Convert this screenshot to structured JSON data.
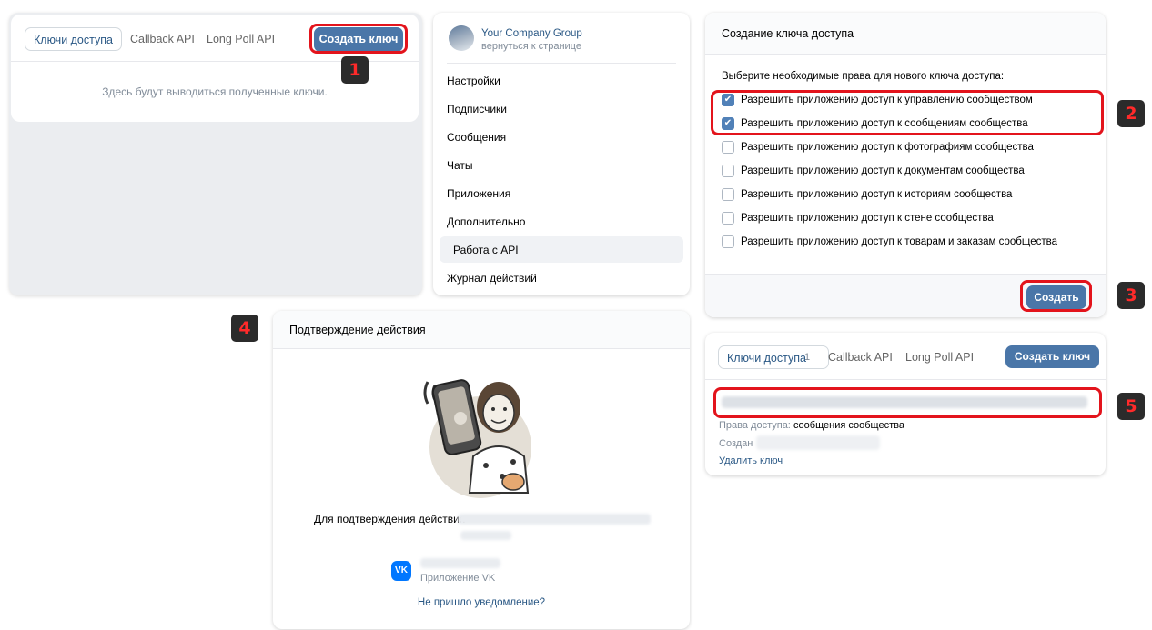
{
  "panel1": {
    "tabs": [
      "Ключи доступа",
      "Callback API",
      "Long Poll API"
    ],
    "create_key_button": "Создать ключ",
    "empty_text": "Здесь будут выводиться полученные ключи.",
    "badge": "1"
  },
  "menu": {
    "group_name": "Your Company Group",
    "back_link": "вернуться к странице",
    "items": [
      "Настройки",
      "Подписчики",
      "Сообщения",
      "Чаты",
      "Приложения",
      "Дополнительно",
      "Работа с API",
      "Журнал действий"
    ],
    "active_item": "Работа с API"
  },
  "panel2": {
    "title": "Создание ключа доступа",
    "intro": "Выберите необходимые права для нового ключа доступа:",
    "permissions": [
      {
        "label": "Разрешить приложению доступ к управлению сообществом",
        "checked": true
      },
      {
        "label": "Разрешить приложению доступ к сообщениям сообщества",
        "checked": true
      },
      {
        "label": "Разрешить приложению доступ к фотографиям сообщества",
        "checked": false
      },
      {
        "label": "Разрешить приложению доступ к документам сообщества",
        "checked": false
      },
      {
        "label": "Разрешить приложению доступ к историям сообщества",
        "checked": false
      },
      {
        "label": "Разрешить приложению доступ к стене сообщества",
        "checked": false
      },
      {
        "label": "Разрешить приложению доступ к товарам и заказам сообщества",
        "checked": false
      }
    ],
    "create_button": "Создать",
    "badge_permissions": "2",
    "badge_create": "3"
  },
  "panel4": {
    "title": "Подтверждение действия",
    "confirm_text": "Для подтверждения действия",
    "app_label": "Приложение VK",
    "vk_logo": "VK",
    "no_notification_link": "Не пришло уведомление?",
    "badge": "4"
  },
  "panel5": {
    "tabs": [
      "Ключи доступа",
      "Callback API",
      "Long Poll API"
    ],
    "key_count": "1",
    "create_key_button": "Создать ключ",
    "rights_label": "Права доступа:",
    "rights_value": "сообщения сообщества",
    "created_label": "Создан",
    "delete_link": "Удалить ключ",
    "badge": "5"
  },
  "colors": {
    "accent": "#4a76a8",
    "highlight": "#e3141c",
    "link": "#2a5885"
  }
}
